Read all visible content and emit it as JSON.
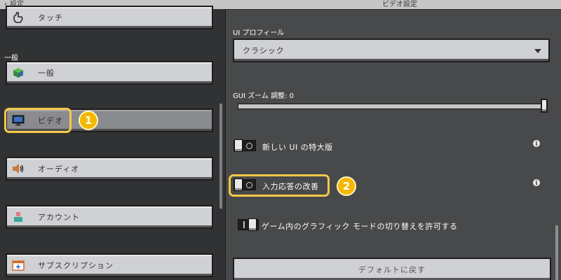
{
  "topbar": {
    "back_label": "設定",
    "title": "ビデオ設定"
  },
  "sidebar": {
    "section_label": "一般",
    "items": [
      {
        "label": "タッチ",
        "icon": "hand-touch-icon"
      },
      {
        "label": "一般",
        "icon": "grass-block-icon"
      },
      {
        "label": "ビデオ",
        "icon": "monitor-icon"
      },
      {
        "label": "オーディオ",
        "icon": "speaker-icon"
      },
      {
        "label": "アカウント",
        "icon": "account-icon"
      },
      {
        "label": "サブスクリプション",
        "icon": "subscription-icon"
      }
    ]
  },
  "main": {
    "ui_profile": {
      "label": "UI プロフィール",
      "value": "クラシック"
    },
    "gui_zoom": {
      "label": "GUI ズーム 調整: 0",
      "fill": 1.0
    },
    "toggles": [
      {
        "label": "新しい UI の特大版",
        "on": false
      },
      {
        "label": "入力応答の改善",
        "on": false
      },
      {
        "label": "ゲーム内のグラフィック モードの切り替えを許可する",
        "on": false
      }
    ],
    "reset_button": "デフォルトに戻す"
  },
  "annotations": {
    "badge_1": "1",
    "badge_2": "2"
  },
  "colors": {
    "accent_highlight": "#f7c948",
    "badge": "#f5b700",
    "button": "#d0d1d4",
    "panel_dark": "#313233",
    "panel_mid": "#48494a"
  }
}
